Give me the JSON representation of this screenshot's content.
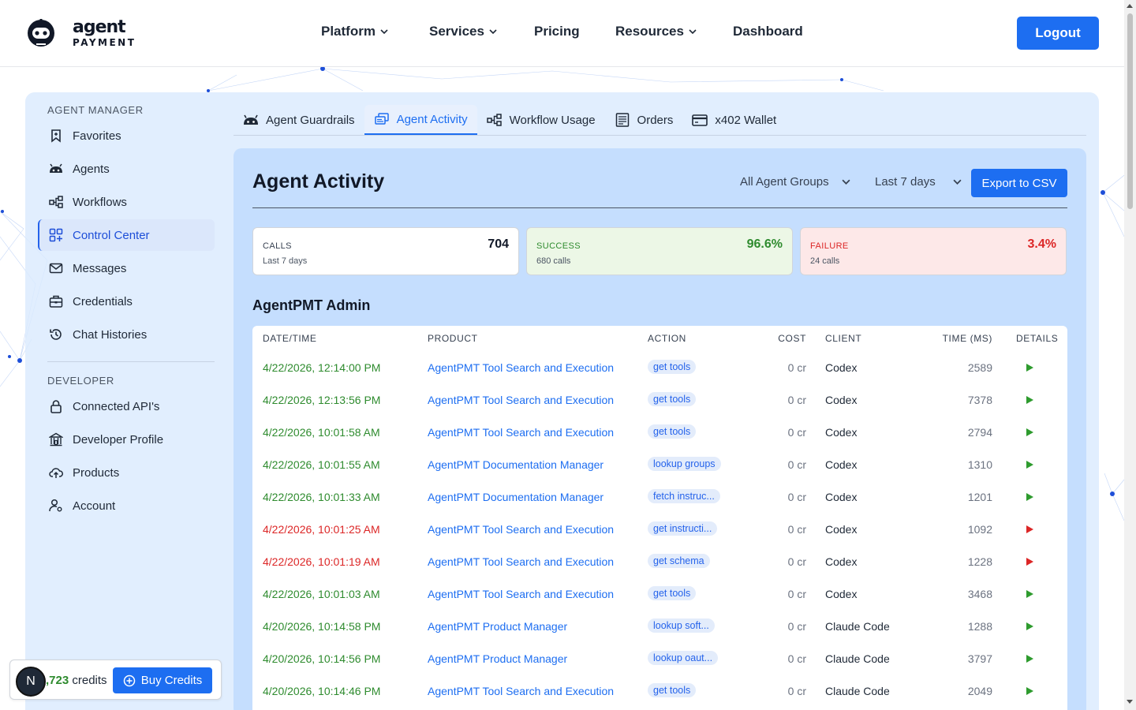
{
  "brand": {
    "word1": "agent",
    "word2": "PAYMENT"
  },
  "nav": {
    "items": [
      {
        "label": "Platform",
        "has_dropdown": true
      },
      {
        "label": "Services",
        "has_dropdown": true
      },
      {
        "label": "Pricing",
        "has_dropdown": false
      },
      {
        "label": "Resources",
        "has_dropdown": true
      },
      {
        "label": "Dashboard",
        "has_dropdown": false
      }
    ],
    "logout_label": "Logout"
  },
  "sidebar": {
    "section1": "AGENT MANAGER",
    "items1": [
      {
        "label": "Favorites",
        "icon": "bookmark-icon"
      },
      {
        "label": "Agents",
        "icon": "robot-icon"
      },
      {
        "label": "Workflows",
        "icon": "workflow-icon"
      },
      {
        "label": "Control Center",
        "icon": "grid-icon",
        "active": true
      },
      {
        "label": "Messages",
        "icon": "mail-icon"
      },
      {
        "label": "Credentials",
        "icon": "briefcase-icon"
      },
      {
        "label": "Chat Histories",
        "icon": "history-icon"
      }
    ],
    "section2": "DEVELOPER",
    "items2": [
      {
        "label": "Connected API's",
        "icon": "lock-icon"
      },
      {
        "label": "Developer Profile",
        "icon": "building-icon"
      },
      {
        "label": "Products",
        "icon": "cloud-upload-icon"
      },
      {
        "label": "Account",
        "icon": "user-settings-icon"
      }
    ]
  },
  "tabs": [
    {
      "label": "Agent Guardrails",
      "icon": "robot-icon"
    },
    {
      "label": "Agent Activity",
      "icon": "activity-icon",
      "active": true
    },
    {
      "label": "Workflow Usage",
      "icon": "workflow-icon"
    },
    {
      "label": "Orders",
      "icon": "receipt-icon"
    },
    {
      "label": "x402 Wallet",
      "icon": "wallet-icon"
    }
  ],
  "activity": {
    "title": "Agent Activity",
    "group_filter": "All Agent Groups",
    "range_filter": "Last 7 days",
    "export_label": "Export to CSV",
    "stats": {
      "calls": {
        "label": "CALLS",
        "sub": "Last 7 days",
        "value": "704"
      },
      "success": {
        "label": "SUCCESS",
        "sub": "680 calls",
        "value": "96.6%"
      },
      "failure": {
        "label": "FAILURE",
        "sub": "24 calls",
        "value": "3.4%"
      }
    },
    "group_title": "AgentPMT Admin",
    "columns": [
      "DATE/TIME",
      "PRODUCT",
      "ACTION",
      "COST",
      "CLIENT",
      "TIME (MS)",
      "DETAILS"
    ],
    "rows": [
      {
        "date": "4/22/2026, 12:14:00 PM",
        "product": "AgentPMT Tool Search and Execution",
        "action": "get tools",
        "cost": "0 cr",
        "client": "Codex",
        "time": "2589",
        "status": "success"
      },
      {
        "date": "4/22/2026, 12:13:56 PM",
        "product": "AgentPMT Tool Search and Execution",
        "action": "get tools",
        "cost": "0 cr",
        "client": "Codex",
        "time": "7378",
        "status": "success"
      },
      {
        "date": "4/22/2026, 10:01:58 AM",
        "product": "AgentPMT Tool Search and Execution",
        "action": "get tools",
        "cost": "0 cr",
        "client": "Codex",
        "time": "2794",
        "status": "success"
      },
      {
        "date": "4/22/2026, 10:01:55 AM",
        "product": "AgentPMT Documentation Manager",
        "action": "lookup groups",
        "cost": "0 cr",
        "client": "Codex",
        "time": "1310",
        "status": "success"
      },
      {
        "date": "4/22/2026, 10:01:33 AM",
        "product": "AgentPMT Documentation Manager",
        "action": "fetch instruc...",
        "cost": "0 cr",
        "client": "Codex",
        "time": "1201",
        "status": "success"
      },
      {
        "date": "4/22/2026, 10:01:25 AM",
        "product": "AgentPMT Tool Search and Execution",
        "action": "get instructi...",
        "cost": "0 cr",
        "client": "Codex",
        "time": "1092",
        "status": "failure"
      },
      {
        "date": "4/22/2026, 10:01:19 AM",
        "product": "AgentPMT Tool Search and Execution",
        "action": "get schema",
        "cost": "0 cr",
        "client": "Codex",
        "time": "1228",
        "status": "failure"
      },
      {
        "date": "4/22/2026, 10:01:03 AM",
        "product": "AgentPMT Tool Search and Execution",
        "action": "get tools",
        "cost": "0 cr",
        "client": "Codex",
        "time": "3468",
        "status": "success"
      },
      {
        "date": "4/20/2026, 10:14:58 PM",
        "product": "AgentPMT Product Manager",
        "action": "lookup soft...",
        "cost": "0 cr",
        "client": "Claude Code",
        "time": "1288",
        "status": "success"
      },
      {
        "date": "4/20/2026, 10:14:56 PM",
        "product": "AgentPMT Product Manager",
        "action": "lookup oaut...",
        "cost": "0 cr",
        "client": "Claude Code",
        "time": "3797",
        "status": "success"
      },
      {
        "date": "4/20/2026, 10:14:46 PM",
        "product": "AgentPMT Tool Search and Execution",
        "action": "get tools",
        "cost": "0 cr",
        "client": "Claude Code",
        "time": "2049",
        "status": "success"
      }
    ]
  },
  "credits": {
    "avatar_letter": "N",
    "amount": ",723",
    "unit": " credits",
    "buy_label": "Buy Credits"
  },
  "colors": {
    "accent": "#1d6ef1",
    "success": "#2e8b2e",
    "failure": "#dc2626"
  }
}
